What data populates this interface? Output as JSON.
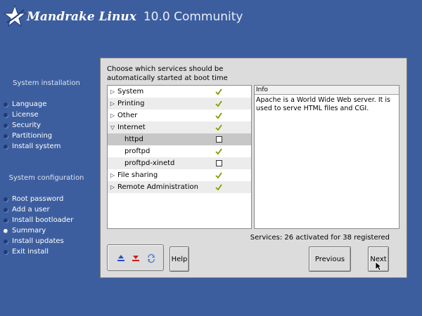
{
  "header": {
    "brand": "Mandrake Linux",
    "version": "10.0 Community"
  },
  "sidebar": {
    "installation_heading": "System installation",
    "installation_items": [
      {
        "label": "Language"
      },
      {
        "label": "License"
      },
      {
        "label": "Security"
      },
      {
        "label": "Partitioning"
      },
      {
        "label": "Install system"
      }
    ],
    "configuration_heading": "System configuration",
    "configuration_items": [
      {
        "label": "Root password"
      },
      {
        "label": "Add a user"
      },
      {
        "label": "Install bootloader"
      },
      {
        "label": "Summary",
        "active": true
      },
      {
        "label": "Install updates"
      },
      {
        "label": "Exit install"
      }
    ]
  },
  "dialog": {
    "prompt": "Choose which services should be automatically started at boot time",
    "services": [
      {
        "label": "System",
        "expander": "collapsed",
        "state": "checked"
      },
      {
        "label": "Printing",
        "expander": "collapsed",
        "state": "checked"
      },
      {
        "label": "Other",
        "expander": "collapsed",
        "state": "checked"
      },
      {
        "label": "Internet",
        "expander": "expanded",
        "state": "checked"
      },
      {
        "label": "httpd",
        "expander": "none",
        "state": "unchecked",
        "selected": true
      },
      {
        "label": "proftpd",
        "expander": "none",
        "state": "checked"
      },
      {
        "label": "proftpd-xinetd",
        "expander": "none",
        "state": "unchecked"
      },
      {
        "label": "File sharing",
        "expander": "collapsed",
        "state": "checked"
      },
      {
        "label": "Remote Administration",
        "expander": "collapsed",
        "state": "checked"
      }
    ],
    "info_label": "Info",
    "info_text": "Apache is a World Wide Web server. It is used to serve HTML files and CGI.",
    "status": "Services: 26 activated for 38 registered",
    "buttons": {
      "help": "Help",
      "previous": "Previous",
      "next": "Next"
    },
    "icons": [
      "expand-all-icon",
      "collapse-all-icon",
      "toggle-all-icon"
    ]
  },
  "colors": {
    "background": "#3d5e9e",
    "panel": "#dcdcdc",
    "check_yellow": "#e0c020",
    "check_green": "#2a8a2a"
  }
}
